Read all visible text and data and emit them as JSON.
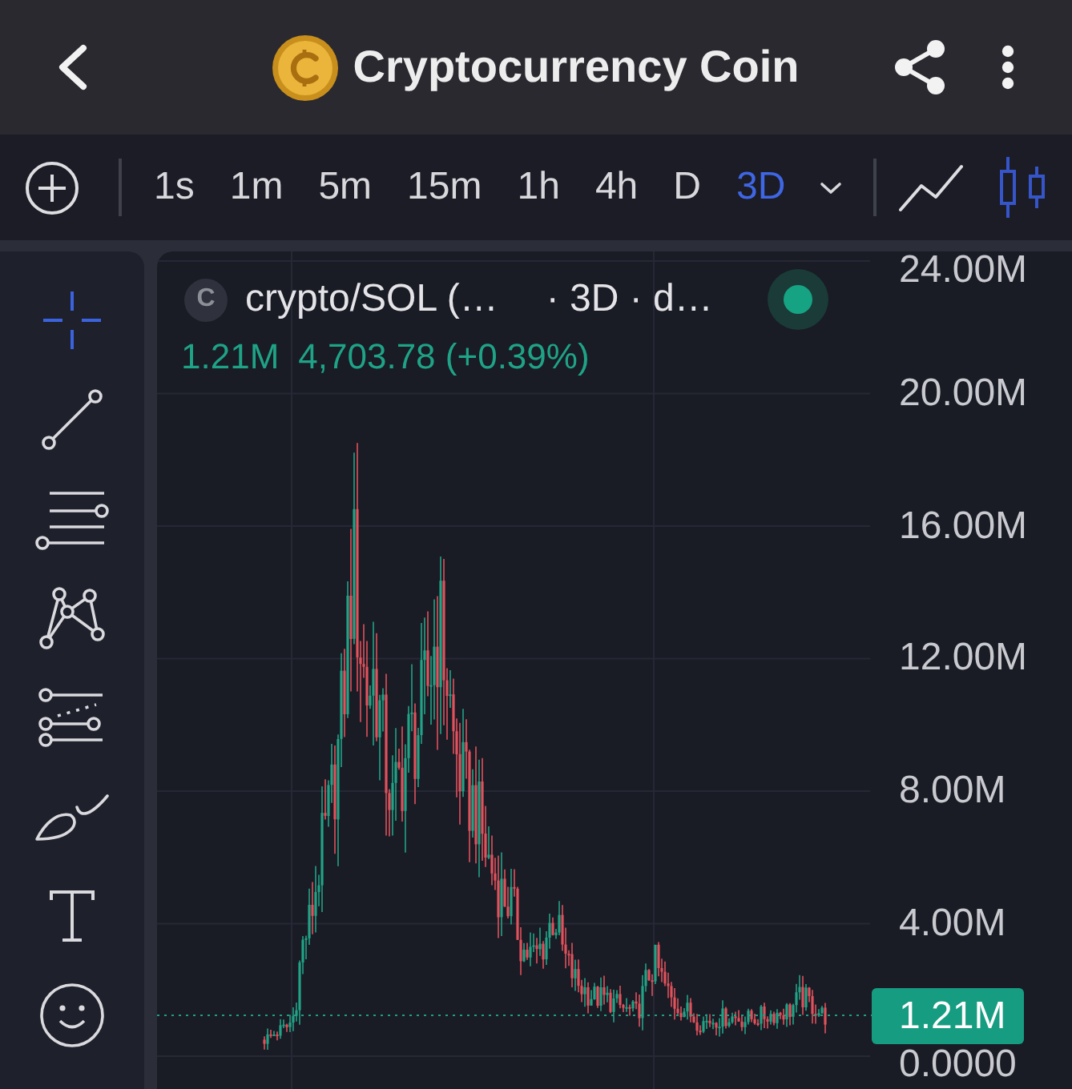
{
  "top_bar": {
    "title": "Cryptocurrency Coin"
  },
  "toolbar": {
    "intervals": [
      {
        "label": "1s",
        "selected": false
      },
      {
        "label": "1m",
        "selected": false
      },
      {
        "label": "5m",
        "selected": false
      },
      {
        "label": "15m",
        "selected": false
      },
      {
        "label": "1h",
        "selected": false
      },
      {
        "label": "4h",
        "selected": false
      },
      {
        "label": "D",
        "selected": false
      },
      {
        "label": "3D",
        "selected": true
      }
    ],
    "chart_types": [
      {
        "kind": "line",
        "selected": false
      },
      {
        "kind": "candles",
        "selected": true
      }
    ]
  },
  "drawing_tools": [
    {
      "kind": "crosshair",
      "selected": true
    },
    {
      "kind": "trend_line",
      "selected": false
    },
    {
      "kind": "parallel_lines",
      "selected": false
    },
    {
      "kind": "pattern",
      "selected": false
    },
    {
      "kind": "fibonacci",
      "selected": false
    },
    {
      "kind": "brush",
      "selected": false
    },
    {
      "kind": "text",
      "selected": false
    },
    {
      "kind": "emoji",
      "selected": false
    }
  ],
  "legend": {
    "badge": "C",
    "symbol": "crypto/SOL (…",
    "details": "· 3D · d…",
    "market_open": true,
    "last_value": "1.21M",
    "quote": "4,703.78 (+0.39%)"
  },
  "price_axis": {
    "labels": [
      "24.00M",
      "20.00M",
      "16.00M",
      "12.00M",
      "8.00M",
      "4.00M",
      "0.0000"
    ],
    "last_price": "1.21M"
  }
}
